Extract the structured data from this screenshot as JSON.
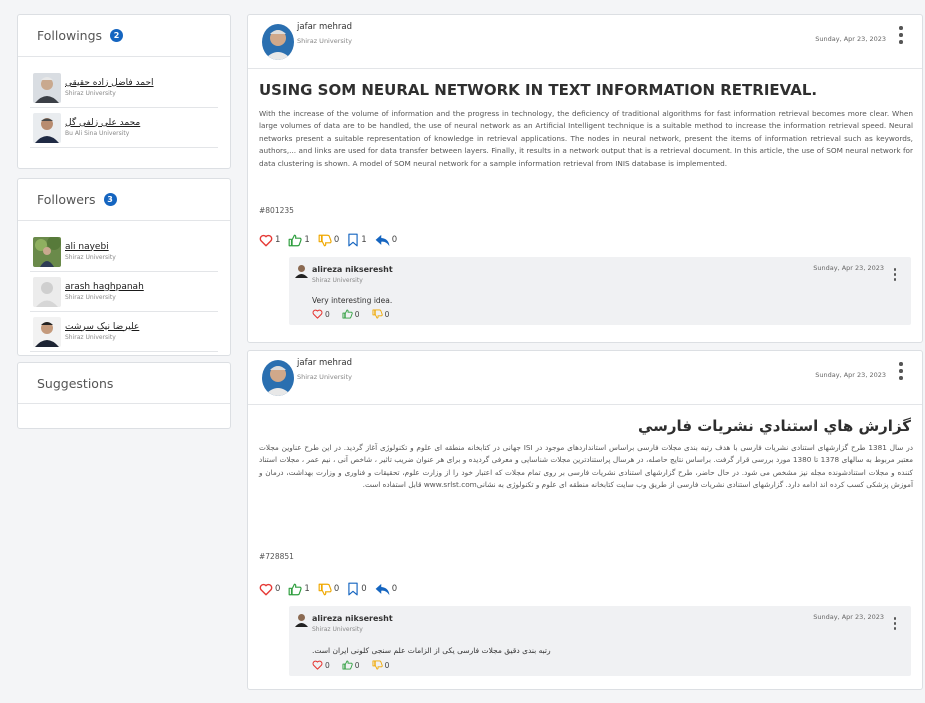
{
  "sidebar": {
    "followings": {
      "title": "Followings",
      "count": "2",
      "people": [
        {
          "name": "احمد فاضل زاده حقیقی",
          "university": "Shiraz University"
        },
        {
          "name": "محمد علی زلفی گل",
          "university": "Bu Ali Sina University"
        }
      ]
    },
    "followers": {
      "title": "Followers",
      "count": "3",
      "people": [
        {
          "name": "ali nayebi",
          "university": "Shiraz University"
        },
        {
          "name": "arash haghpanah",
          "university": "Shiraz University"
        },
        {
          "name": "علیرضا نیک سرشت",
          "university": "Shiraz University"
        }
      ]
    },
    "suggestions": {
      "title": "Suggestions"
    }
  },
  "posts": [
    {
      "author": "jafar mehrad",
      "university": "Shiraz University",
      "date": "Sunday, Apr 23, 2023",
      "title": "USING SOM NEURAL NETWORK IN TEXT INFORMATION RETRIEVAL.",
      "abstract": "With the increase of the volume of information and the progress in technology, the deficiency of traditional algorithms for fast information retrieval becomes more clear. When large volumes of data are to be handled, the use of neural network as an Artificial Intelligent technique is a suitable method to increase the information retrieval speed. Neural networks present a suitable representation of knowledge in retrieval applications. The nodes in neural network, present the items of information retrieval such as keywords, authors,... and links are used for data transfer between layers. Finally, it results in a network output that is a retrieval document. In this article, the use of SOM neural network for data clustering is shown. A model of SOM neural network for a sample information retrieval from INIS database is implemented.",
      "id": "#801235",
      "counts": {
        "likes": "1",
        "upvotes": "1",
        "downvotes": "0",
        "saves": "1",
        "shares": "0"
      },
      "comment": {
        "author": "alireza nikseresht",
        "university": "Shiraz University",
        "date": "Sunday, Apr 23, 2023",
        "text": "Very interesting idea.",
        "counts": {
          "likes": "0",
          "upvotes": "0",
          "downvotes": "0"
        }
      }
    },
    {
      "author": "jafar mehrad",
      "university": "Shiraz University",
      "date": "Sunday, Apr 23, 2023",
      "title": "گزارش هاي استنادي نشريات فارسي",
      "abstract": "در سال 1381 طرح گزارشهای استنادی نشریات فارسی با هدف رتبه بندی مجلات فارسی براساس استانداردهای موجود در ISI جهانی در کتابخانه منطقه ای علوم و تکنولوژی آغاز گردید. در این طرح عناوین مجلات معتبر مربوط به سالهای 1378 تا 1380 مورد بررسی قرار گرفت. براساس نتایج حاصله، در هرسال پراستنادترین مجلات شناسایی و معرفی گردیده و برای هر عنوان ضریب تاثیر ، شاخص آنی ، نیم عمر ، مجلات استناد کننده و مجلات استنادشونده مجله نیز مشخص می شود. در حال حاضر، طرح گزارشهای استنادی نشریات فارسی بر روی تمام مجلات که اعتبار خود را از وزارت علوم، تحقیقات و فناوری و وزارت بهداشت، درمان و آموزش پزشکی کسب کرده اند ادامه دارد. گزارشهای استنادی نشریات فارسی از طریق وب سایت کتابخانه منطقه ای علوم و تکنولوژی به نشانیwww.srlst.com قابل استفاده است.",
      "id": "#728851",
      "counts": {
        "likes": "0",
        "upvotes": "1",
        "downvotes": "0",
        "saves": "0",
        "shares": "0"
      },
      "comment": {
        "author": "alireza nikseresht",
        "university": "Shiraz University",
        "date": "Sunday, Apr 23, 2023",
        "text": ".رتبه بندی دقیق مجلات فارسی یکی از الزامات علم سنجی کلونی ایران است",
        "counts": {
          "likes": "0",
          "upvotes": "0",
          "downvotes": "0"
        }
      }
    }
  ],
  "colors": {
    "badge": "#1565c0",
    "heart": "#e53935",
    "thumb_up": "#2e9e3e",
    "thumb_down": "#f0a800",
    "bookmark": "#1565c0",
    "share": "#1565c0"
  },
  "icons": [
    "heart-icon",
    "thumb-up-icon",
    "thumb-down-icon",
    "bookmark-icon",
    "reply-icon",
    "kebab-menu-icon"
  ]
}
